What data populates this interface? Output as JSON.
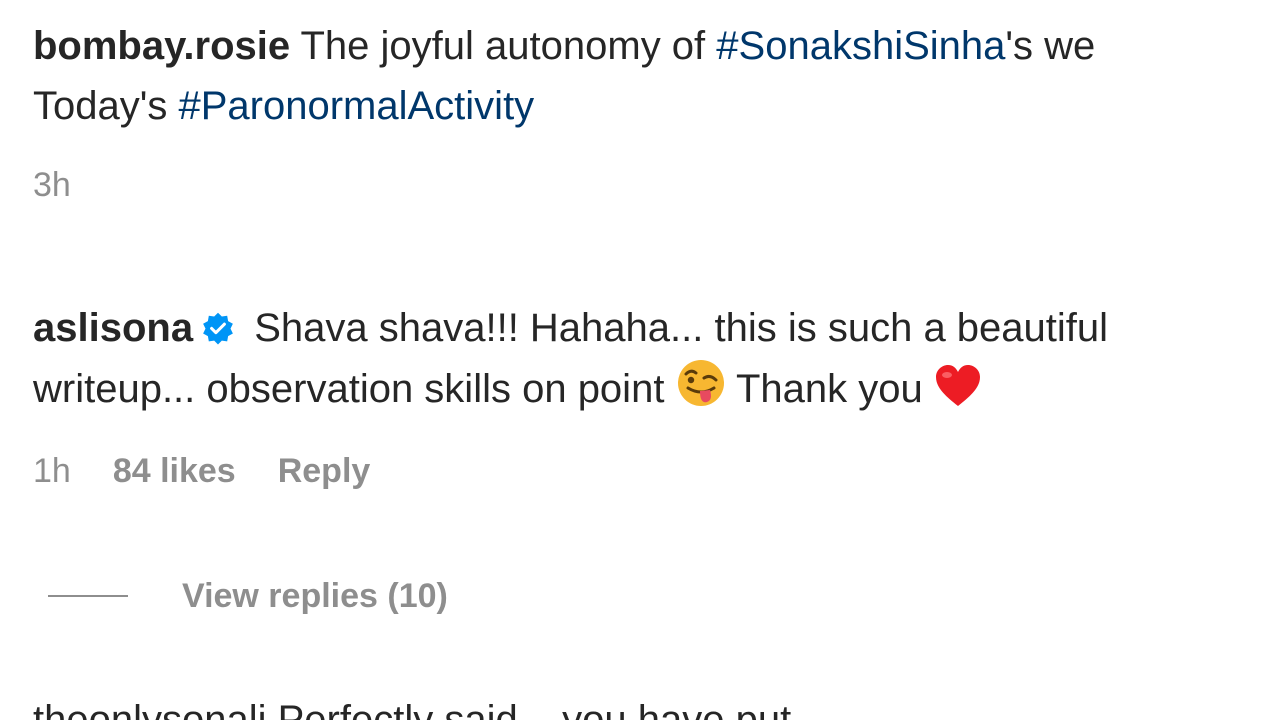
{
  "comment1": {
    "username": "bombay.rosie",
    "text_a": " The joyful autonomy of ",
    "hashtag1": "#SonakshiSinha",
    "text_b": "'s we",
    "line2_a": "Today's ",
    "hashtag2": "#ParonormalActivity",
    "time": "3h"
  },
  "comment2": {
    "username": "aslisona",
    "verified_icon": "verified-badge-icon",
    "line1": " Shava shava!!! Hahaha... this is such a beautiful",
    "line2_a": "writeup... observation skills on point ",
    "emoji1": "winking-face-with-tongue-emoji",
    "line2_b": " Thank you ",
    "emoji2": "red-heart-emoji",
    "time": "1h",
    "likes": "84 likes",
    "reply": "Reply",
    "view_replies": "View replies (10)"
  },
  "comment3": {
    "partial_text": "theonlysonali Perfectly said... you have put..."
  },
  "colors": {
    "text": "#262626",
    "muted": "#8e8e8e",
    "hashtag": "#00376b",
    "verified": "#0095f6",
    "heart": "#ed4956"
  }
}
